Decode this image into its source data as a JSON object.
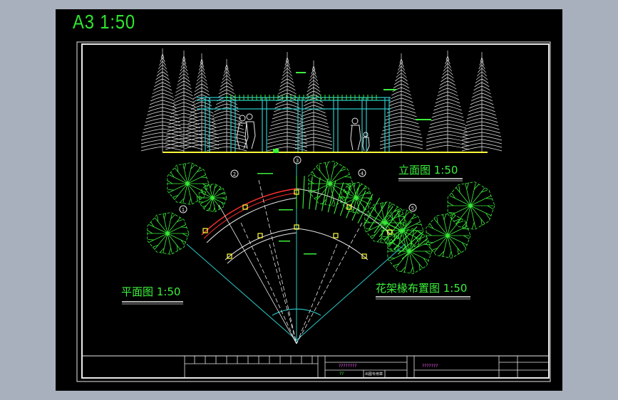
{
  "sheet": {
    "title": "A3  1:50"
  },
  "labels": {
    "elevation": "立面图 1:50",
    "plan": "平面图 1:50",
    "rafter_plan": "花架椽布置图 1:50"
  },
  "axis_markers": [
    "1",
    "2",
    "3",
    "4",
    "5"
  ],
  "title_block": {
    "drawing_name_1": "????????",
    "drawing_name_2": "???????",
    "project_code": "??",
    "stamp": "出图专用章"
  },
  "colors": {
    "cad_green": "#3cf03c",
    "cad_cyan": "#2bc8c8",
    "cad_yellow": "#ffff3c",
    "cad_red": "#ff3030",
    "cad_white": "#e8e8e8",
    "sheet_bg": "#000000",
    "viewport_bg": "#a9b0bd"
  }
}
